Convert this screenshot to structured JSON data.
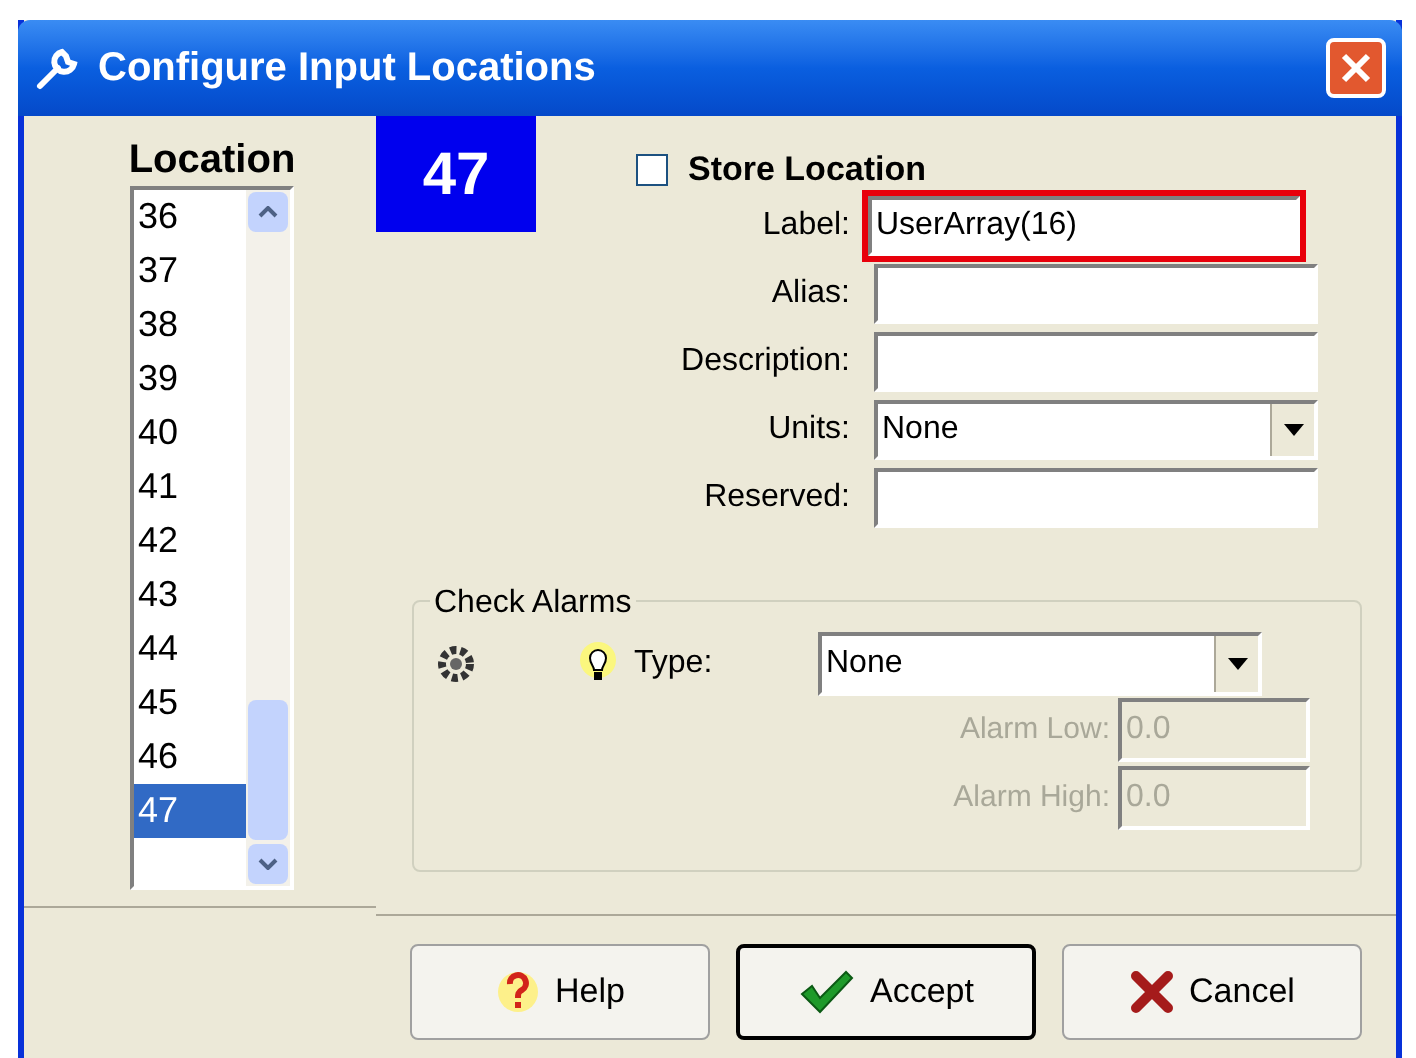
{
  "window": {
    "title": "Configure Input Locations"
  },
  "location_list": {
    "heading": "Location",
    "items": [
      {
        "label": "36",
        "selected": false
      },
      {
        "label": "37",
        "selected": false
      },
      {
        "label": "38",
        "selected": false
      },
      {
        "label": "39",
        "selected": false
      },
      {
        "label": "40",
        "selected": false
      },
      {
        "label": "41",
        "selected": false
      },
      {
        "label": "42",
        "selected": false
      },
      {
        "label": "43",
        "selected": false
      },
      {
        "label": "44",
        "selected": false
      },
      {
        "label": "45",
        "selected": false
      },
      {
        "label": "46",
        "selected": false
      },
      {
        "label": "47",
        "selected": true
      }
    ]
  },
  "current_location": "47",
  "store_location": {
    "label": "Store Location",
    "checked": false
  },
  "fields": [
    {
      "kind": "text",
      "label": "Label:",
      "value": "UserArray(16)",
      "highlighted": true
    },
    {
      "kind": "text",
      "label": "Alias:",
      "highlighted": false
    },
    {
      "kind": "text",
      "label": "Description:",
      "highlighted": false
    },
    {
      "kind": "select",
      "label": "Units:",
      "value": "None",
      "highlighted": false
    },
    {
      "kind": "text",
      "label": "Reserved:",
      "highlighted": false
    }
  ],
  "check_alarms": {
    "title": "Check Alarms",
    "type_label": "Type:",
    "type_value": "None",
    "fields": [
      {
        "label": "Alarm Low:",
        "value": "0.0",
        "disabled": true
      },
      {
        "label": "Alarm High:",
        "value": "0.0",
        "disabled": true
      }
    ]
  },
  "buttons": [
    {
      "kind": "help",
      "label": "Help",
      "default": false
    },
    {
      "kind": "accept",
      "label": "Accept",
      "default": true
    },
    {
      "kind": "cancel",
      "label": "Cancel",
      "default": false
    }
  ]
}
